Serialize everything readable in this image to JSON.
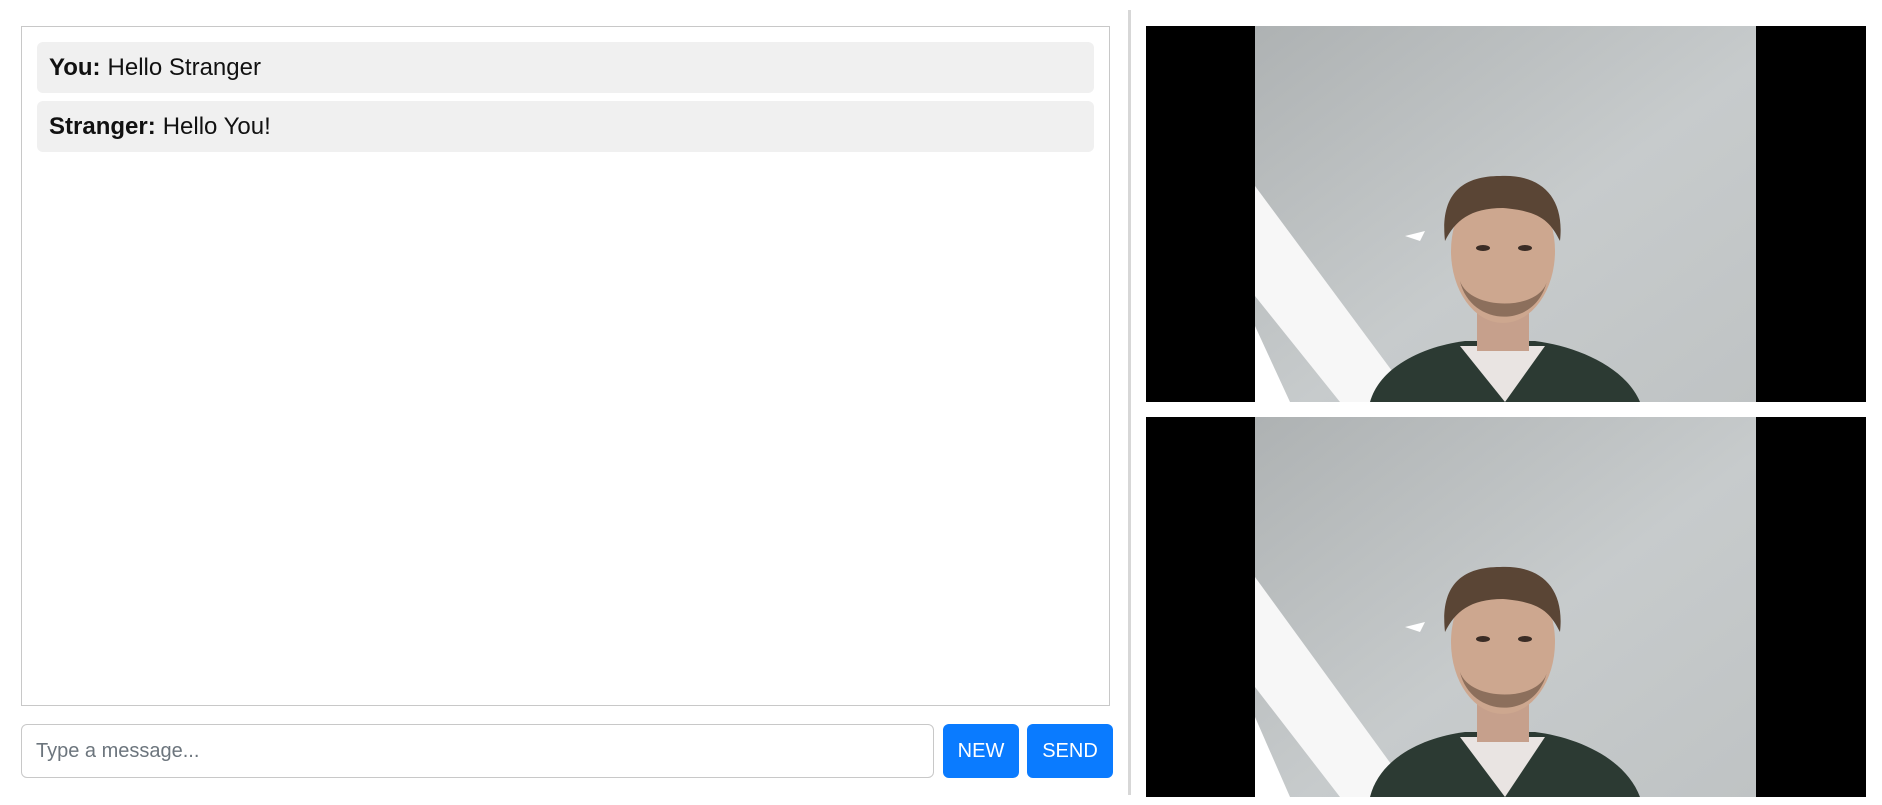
{
  "chat": {
    "messages": [
      {
        "sender": "You:",
        "text": "Hello Stranger"
      },
      {
        "sender": "Stranger:",
        "text": "Hello You!"
      }
    ]
  },
  "composer": {
    "placeholder": "Type a message...",
    "value": "",
    "new_label": "NEW",
    "send_label": "SEND"
  },
  "videos": {
    "remote_feed": "camera-feed",
    "local_feed": "camera-feed"
  },
  "colors": {
    "accent": "#0a7bff",
    "message_bg": "#f0f0f0",
    "video_bg": "#000000"
  }
}
